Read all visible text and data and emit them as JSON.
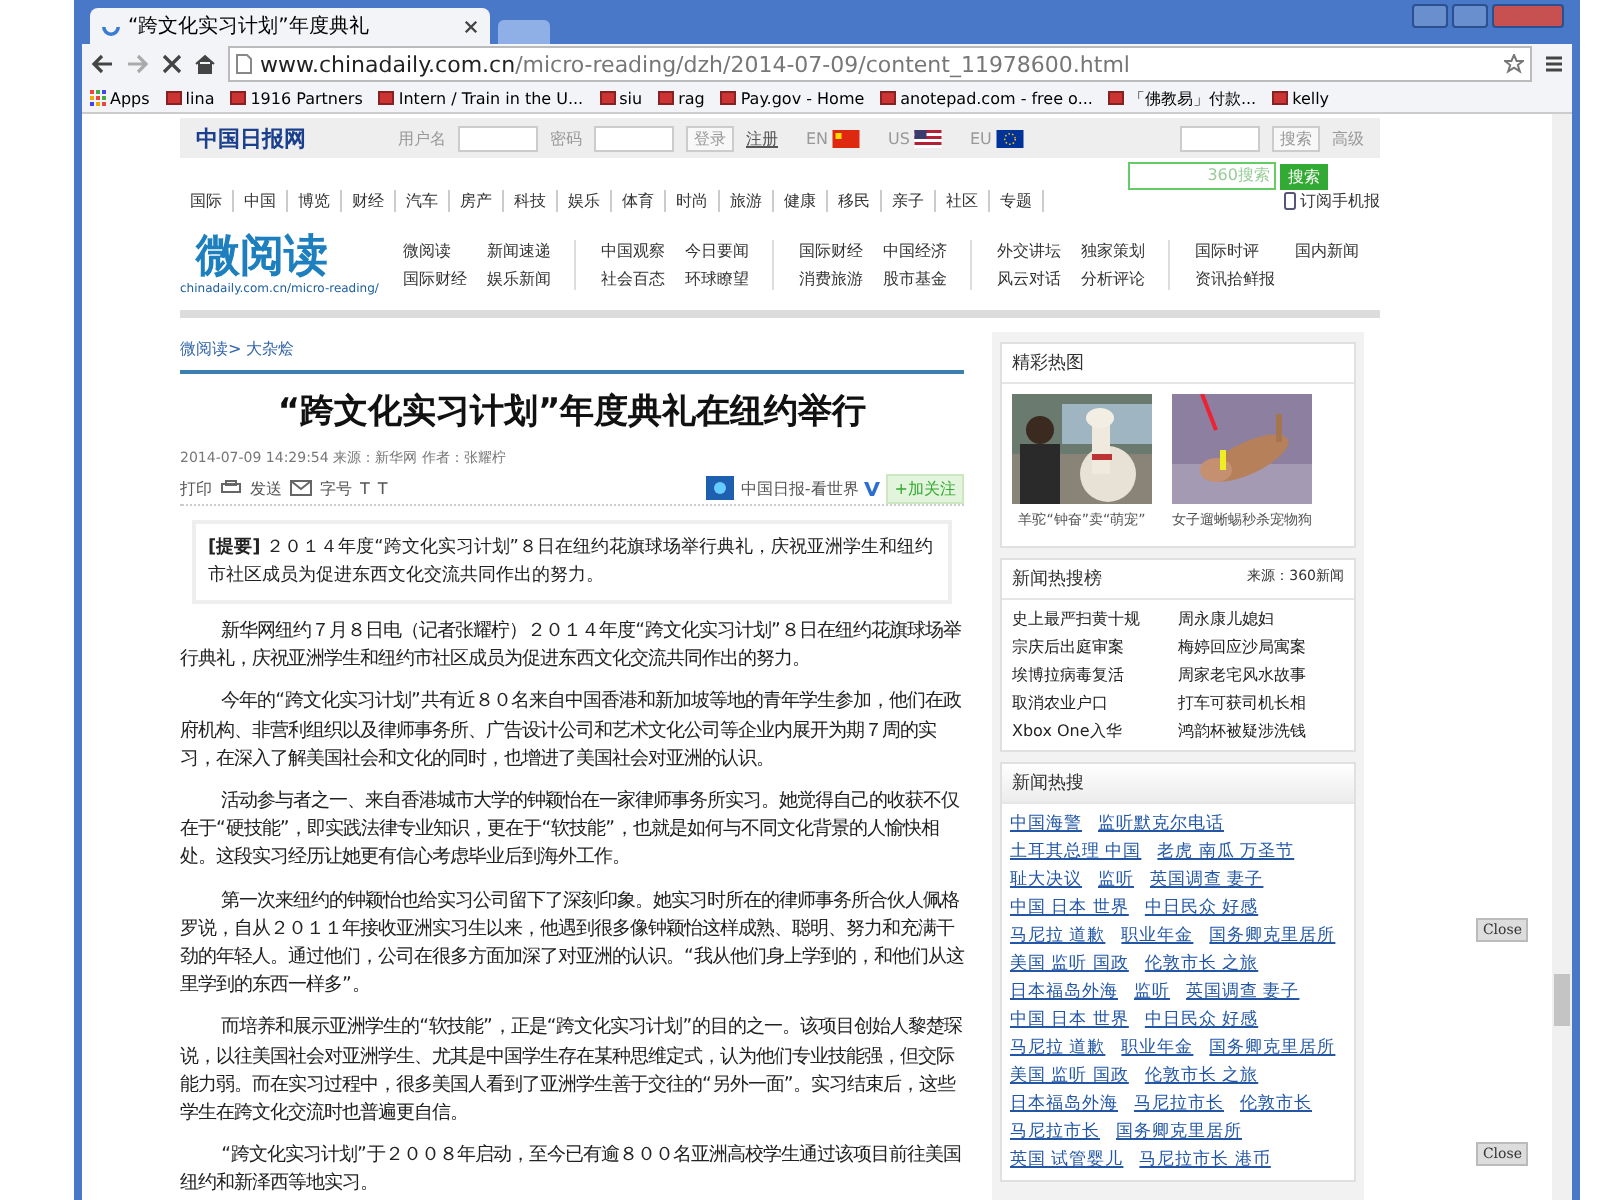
{
  "browser": {
    "tab_title": "“跨文化实习计划”年度典礼",
    "url_host": "www.chinadaily.com.cn",
    "url_path": "/micro-reading/dzh/2014-07-09/content_11978600.html",
    "bookmarks": [
      "Apps",
      "lina",
      "1916 Partners",
      "Intern / Train in the U...",
      "siu",
      "rag",
      "Pay.gov - Home",
      "anotepad.com - free o...",
      "「佛教易」付款...",
      "kelly"
    ]
  },
  "header": {
    "logo": "中国日报网",
    "username_label": "用户名",
    "password_label": "密码",
    "login_button": "登录",
    "register_link": "注册",
    "editions": [
      "EN",
      "US",
      "EU"
    ],
    "search_button": "搜索",
    "advanced_link": "高级",
    "search360_logo": "360搜索",
    "search360_button": "搜索"
  },
  "nav": [
    "国际",
    "中国",
    "博览",
    "财经",
    "汽车",
    "房产",
    "科技",
    "娱乐",
    "体育",
    "时尚",
    "旅游",
    "健康",
    "移民",
    "亲子",
    "社区",
    "专题"
  ],
  "subscribe_link": "订阅手机报",
  "micro": {
    "logo": "微阅读",
    "url": "chinadaily.com.cn/micro-reading/",
    "groups": [
      [
        "微阅读",
        "新闻速递",
        "国际财经",
        "娱乐新闻"
      ],
      [
        "中国观察",
        "今日要闻",
        "社会百态",
        "环球瞭望"
      ],
      [
        "国际财经",
        "中国经济",
        "消费旅游",
        "股市基金"
      ],
      [
        "外交讲坛",
        "独家策划",
        "风云对话",
        "分析评论"
      ],
      [
        "国际时评",
        "国内新闻",
        "资讯拾鲜报"
      ]
    ]
  },
  "article": {
    "breadcrumb": "微阅读> 大杂烩",
    "title": "“跨文化实习计划”年度典礼在纽约举行",
    "meta": "2014-07-09 14:29:54  来源：新华网  作者：张耀柠",
    "print": "打印",
    "send": "发送",
    "font_size": "字号",
    "font_small": "T",
    "font_large": "T",
    "weibo": "中国日报-看世界",
    "follow": "+加关注",
    "summary_label": "[提要]",
    "summary": "２０１４年度“跨文化实习计划”８日在纽约花旗球场举行典礼，庆祝亚洲学生和纽约市社区成员为促进东西文化交流共同作出的努力。",
    "paragraphs": [
      "新华网纽约７月８日电（记者张耀柠）２０１４年度“跨文化实习计划”８日在纽约花旗球场举行典礼，庆祝亚洲学生和纽约市社区成员为促进东西文化交流共同作出的努力。",
      "今年的“跨文化实习计划”共有近８０名来自中国香港和新加坡等地的青年学生参加，他们在政府机构、非营利组织以及律师事务所、广告设计公司和艺术文化公司等企业内展开为期７周的实习，在深入了解美国社会和文化的同时，也增进了美国社会对亚洲的认识。",
      "活动参与者之一、来自香港城市大学的钟颖怡在一家律师事务所实习。她觉得自己的收获不仅在于“硬技能”，即实践法律专业知识，更在于“软技能”，也就是如何与不同文化背景的人愉快相处。这段实习经历让她更有信心考虑毕业后到海外工作。",
      "第一次来纽约的钟颖怡也给实习公司留下了深刻印象。她实习时所在的律师事务所合伙人佩格罗说，自从２０１１年接收亚洲实习生以来，他遇到很多像钟颖怡这样成熟、聪明、努力和充满干劲的年轻人。通过他们，公司在很多方面加深了对亚洲的认识。“我从他们身上学到的，和他们从这里学到的东西一样多”。",
      "而培养和展示亚洲学生的“软技能”，正是“跨文化实习计划”的目的之一。该项目创始人黎楚琛说，以往美国社会对亚洲学生、尤其是中国学生存在某种思维定式，认为他们专业技能强，但交际能力弱。而在实习过程中，很多美国人看到了亚洲学生善于交往的“另外一面”。实习结束后，这些学生在跨文化交流时也普遍更自信。",
      "“跨文化实习计划”于２００８年启动，至今已有逾８００名亚洲高校学生通过该项目前往美国纽约和新泽西等地实习。"
    ]
  },
  "sidebar": {
    "photos": {
      "title": "精彩热图",
      "captions": [
        "羊驼“钟奋”卖“萌宠”",
        "女子遛蜥蜴秒杀宠物狗"
      ]
    },
    "hot_list": {
      "title": "新闻热搜榜",
      "source": "来源：360新闻",
      "items": [
        "史上最严扫黄十规",
        "周永康儿媳妇",
        "宗庆后出庭审案",
        "梅婷回应沙局寓案",
        "埃博拉病毒复活",
        "周家老宅风水故事",
        "取消农业户口",
        "打车可获司机长相",
        "Xbox One入华",
        "鸿韵杯被疑涉洗钱"
      ]
    },
    "hot_search": {
      "title": "新闻热搜",
      "tags": [
        "中国海警",
        "监听默克尔电话",
        "土耳其总理 中国",
        "老虎 南瓜 万圣节",
        "耻大决议",
        "监听",
        "英国调查 妻子",
        "中国 日本 世界",
        "中日民众 好感",
        "马尼拉 道歉",
        "职业年金",
        "国务卿克里居所",
        "美国 监听 国政",
        "伦敦市长 之旅",
        "日本福岛外海",
        "监听",
        "英国调查 妻子",
        "中国 日本 世界",
        "中日民众 好感",
        "马尼拉 道歉",
        "职业年金",
        "国务卿克里居所",
        "美国 监听 国政",
        "伦敦市长 之旅",
        "日本福岛外海",
        "马尼拉市长",
        "伦敦市长",
        "马尼拉市长",
        "国务卿克里居所",
        "英国 试管婴儿",
        "马尼拉市长 港币"
      ]
    }
  },
  "close_buttons": [
    "Close",
    "Close"
  ]
}
